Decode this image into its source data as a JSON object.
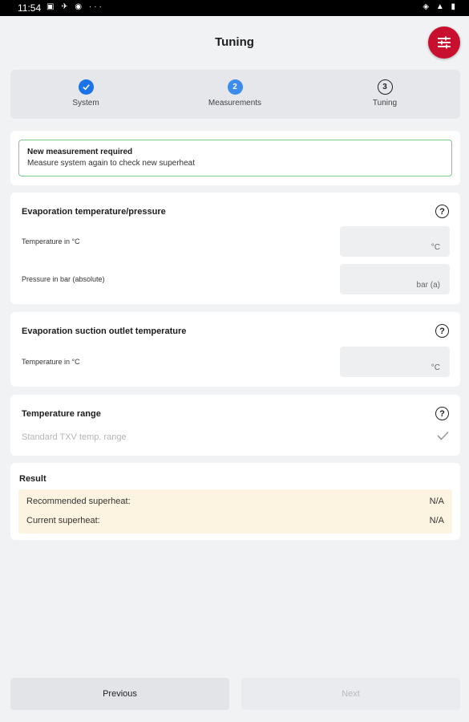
{
  "status_bar": {
    "time": "11:54",
    "left_icons": "▣ ✈ ◉ ···",
    "right_icons": "◈ ▲ ▮"
  },
  "header": {
    "title": "Tuning",
    "menu_icon": "tune-icon"
  },
  "stepper": {
    "steps": [
      {
        "label": "System",
        "marker": "✓",
        "state": "done"
      },
      {
        "label": "Measurements",
        "marker": "2",
        "state": "active"
      },
      {
        "label": "Tuning",
        "marker": "3",
        "state": "todo"
      }
    ]
  },
  "notice": {
    "title": "New measurement required",
    "description": "Measure system again to check new superheat"
  },
  "evaporation": {
    "title": "Evaporation temperature/pressure",
    "help": "?",
    "temp_label": "Temperature in °C",
    "temp_unit": "°C",
    "pressure_label": "Pressure in bar (absolute)",
    "pressure_unit": "bar (a)"
  },
  "suction": {
    "title": "Evaporation suction outlet temperature",
    "help": "?",
    "temp_label": "Temperature in °C",
    "temp_unit": "°C"
  },
  "range": {
    "title": "Temperature range",
    "help": "?",
    "option": "Standard TXV temp. range",
    "selected_icon": "check-icon"
  },
  "result": {
    "title": "Result",
    "rows": [
      {
        "label": "Recommended superheat:",
        "value": "N/A"
      },
      {
        "label": "Current superheat:",
        "value": "N/A"
      }
    ]
  },
  "footer": {
    "previous": "Previous",
    "next": "Next"
  },
  "colors": {
    "accent": "#c8102e",
    "step_blue": "#1a73e8",
    "notice_border": "#7acb8c",
    "result_bg": "#fdf3e1"
  }
}
